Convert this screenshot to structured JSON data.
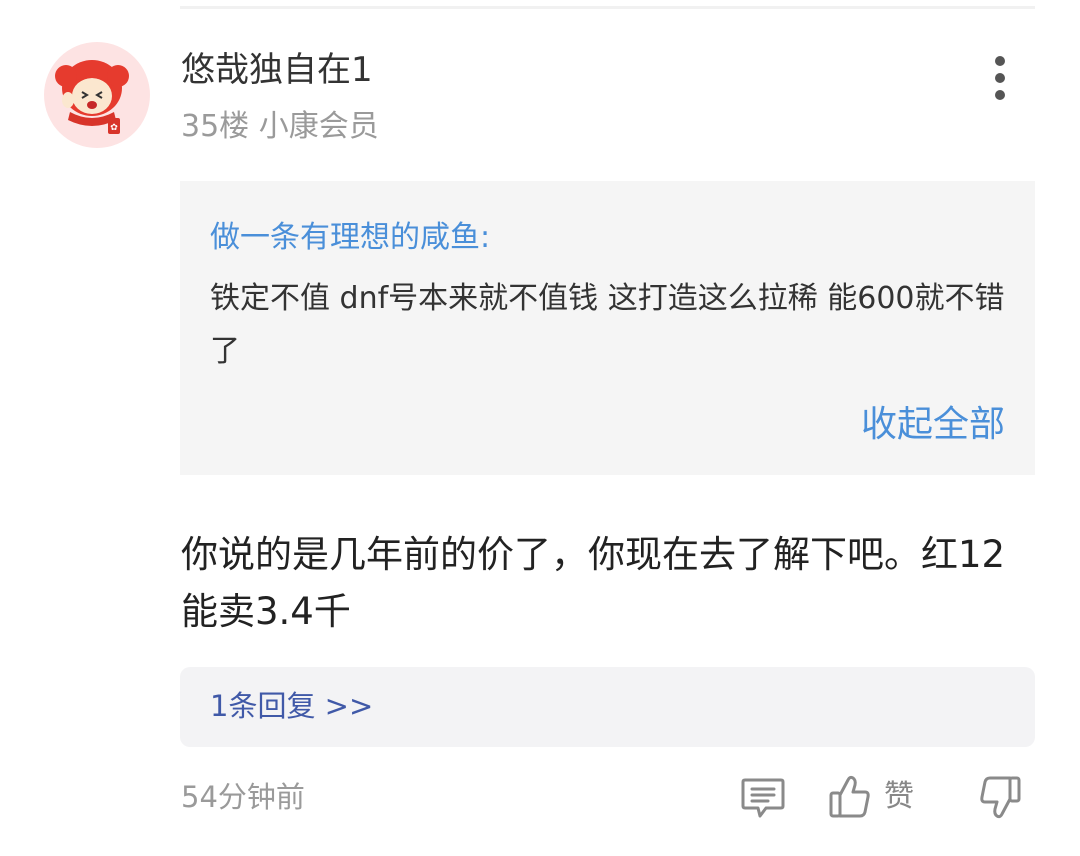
{
  "comment": {
    "username": "悠哉独自在1",
    "floor": "35楼",
    "member_level": "小康会员",
    "quote": {
      "author": "做一条有理想的咸鱼:",
      "text": "铁定不值 dnf号本来就不值钱 这打造这么拉稀 能600就不错了",
      "collapse_label": "收起全部"
    },
    "text": "你说的是几年前的价了，你现在去了解下吧。红12能卖3.4千",
    "replies_label": "1条回复 >>",
    "timestamp": "54分钟前",
    "like_label": "赞"
  },
  "icons": {
    "more": "more-vertical-icon",
    "reply": "comment-icon",
    "like": "thumbs-up-icon",
    "dislike": "thumbs-down-icon"
  },
  "colors": {
    "link_blue": "#4a8fd9",
    "reply_blue": "#4059a8",
    "muted_gray": "#9a9a9a",
    "avatar_bg": "#fde3e3"
  }
}
